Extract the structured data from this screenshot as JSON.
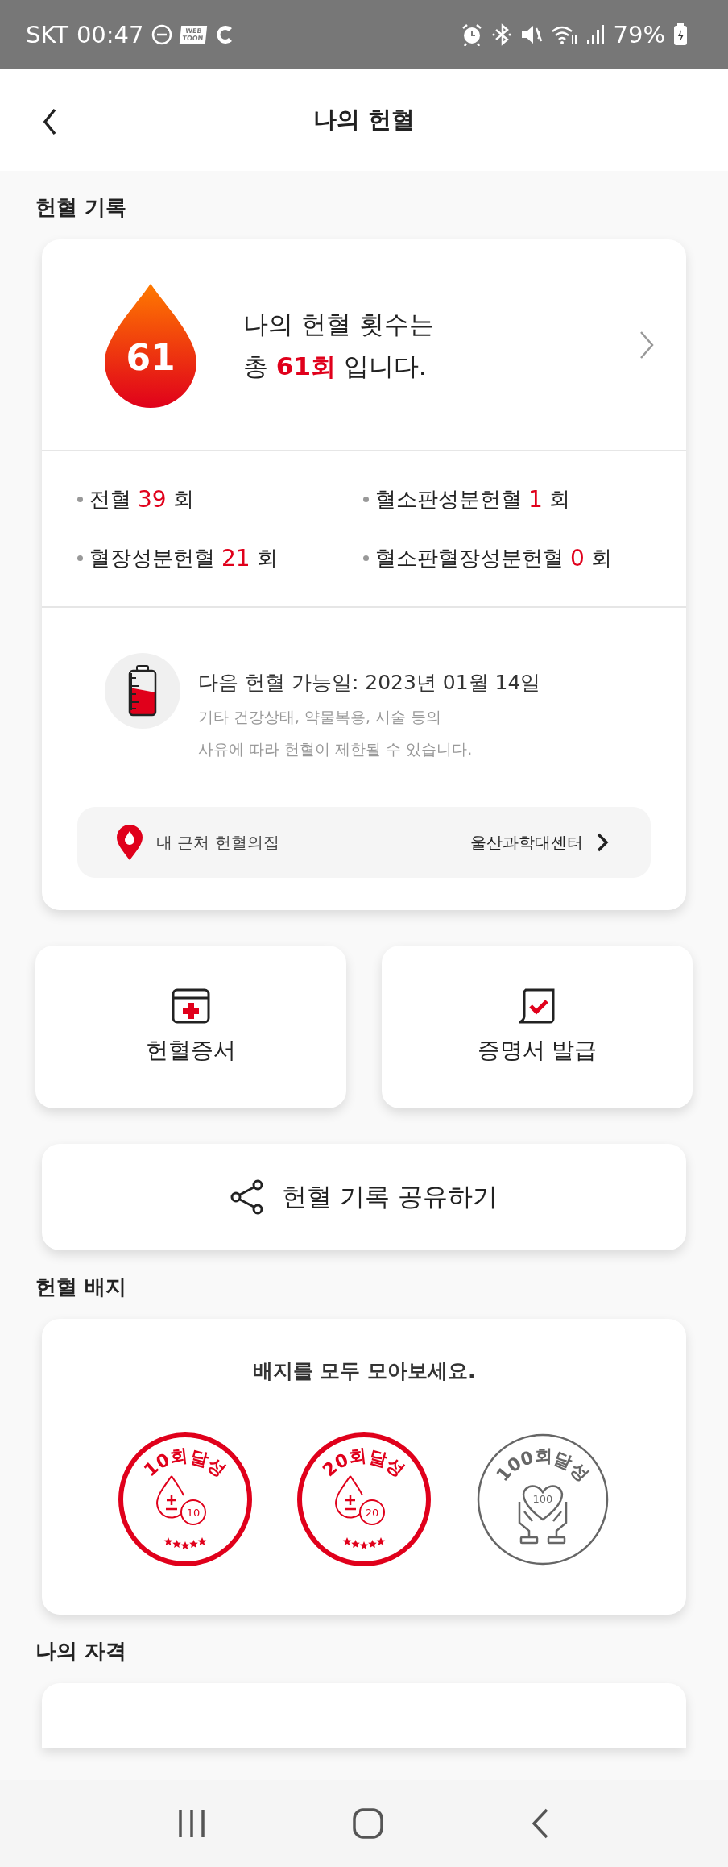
{
  "status_bar": {
    "carrier": "SKT",
    "time": "00:47",
    "app_badge": [
      "WEB",
      "TOON"
    ],
    "battery": "79%"
  },
  "header": {
    "title": "나의 헌혈"
  },
  "donation_record": {
    "heading": "헌혈 기록",
    "drop_count": "61",
    "summary": [
      "나의 헌혈 횟수는",
      "총 **61회** 입니다."
    ],
    "stats": [
      {
        "label": "전혈",
        "count": "39",
        "unit": "회"
      },
      {
        "label": "혈소판성분헌혈",
        "count": "1",
        "unit": "회"
      },
      {
        "label": "혈장성분헌혈",
        "count": "21",
        "unit": "회"
      },
      {
        "label": "혈소판혈장성분헌혈",
        "count": "0",
        "unit": "회"
      }
    ],
    "next_date": "다음 헌혈 가능일: 2023년 01월 14일",
    "notice": [
      "기타 건강상태, 약물복용, 시술 등의",
      "사유에 따라 헌혈이 제한될 수 있습니다."
    ],
    "nearby": {
      "label": "내 근처 헌혈의집",
      "value": "울산과학대센터"
    }
  },
  "actions": [
    {
      "kind": "certificate",
      "label": "헌혈증서"
    },
    {
      "kind": "document",
      "label": "증명서 발급"
    }
  ],
  "share": {
    "label": "헌혈 기록 공유하기"
  },
  "badge_section": {
    "heading": "헌혈 배지",
    "prompt": "배지를 모두 모아보세요.",
    "badges": [
      {
        "kind": "drop",
        "title": "10회달성",
        "number": "10",
        "achieved": true
      },
      {
        "kind": "drop",
        "title": "20회달성",
        "number": "20",
        "achieved": true
      },
      {
        "kind": "hands",
        "title": "100회달성",
        "number": "100",
        "achieved": false
      }
    ]
  },
  "qualification": {
    "heading": "나의 자격"
  }
}
